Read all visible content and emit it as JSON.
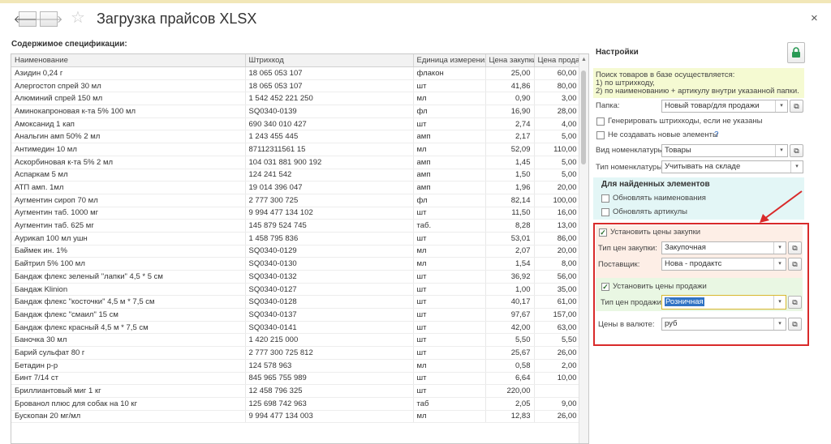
{
  "window": {
    "title": "Загрузка прайсов XLSX",
    "back_icon": "arrow-left-icon",
    "forward_icon": "arrow-right-icon",
    "favorite_icon": "star-icon",
    "close_glyph": "×"
  },
  "spec": {
    "section_label": "Содержимое спецификации:",
    "columns": [
      "Наименование",
      "Штрихкод",
      "Единица измерения",
      "Цена закупки",
      "Цена продажи"
    ],
    "rows": [
      [
        "Азидин 0,24 г",
        "18 065 053 107",
        "флакон",
        "25,00",
        "60,00"
      ],
      [
        "Алергостоп спрей 30 мл",
        "18 065 053 107",
        "шт",
        "41,86",
        "80,00"
      ],
      [
        "Алюминий спрей 150 мл",
        "1 542 452 221 250",
        "мл",
        "0,90",
        "3,00"
      ],
      [
        "Аминокапроновая к-та 5% 100 мл",
        "SQ0340-0139",
        "фл",
        "16,90",
        "28,00"
      ],
      [
        "Амоксанид 1 кап",
        "690 340 010 427",
        "шт",
        "2,74",
        "4,00"
      ],
      [
        "Анальгин амп 50% 2 мл",
        "1 243 455 445",
        "амп",
        "2,17",
        "5,00"
      ],
      [
        "Антимедин 10 мл",
        "87112311561 15",
        "мл",
        "52,09",
        "110,00"
      ],
      [
        "Аскорбиновая к-та 5% 2 мл",
        "104 031 881 900 192",
        "амп",
        "1,45",
        "5,00"
      ],
      [
        "Аспаркам 5 мл",
        "124 241 542",
        "амп",
        "1,50",
        "5,00"
      ],
      [
        "АТП амп. 1мл",
        "19 014 396 047",
        "амп",
        "1,96",
        "20,00"
      ],
      [
        "Аугментин сироп 70 мл",
        "2 777 300 725",
        "фл",
        "82,14",
        "100,00"
      ],
      [
        "Аугментин таб. 1000 мг",
        "9 994 477 134 102",
        "шт",
        "11,50",
        "16,00"
      ],
      [
        "Аугментин таб. 625 мг",
        "145 879 524 745",
        "таб.",
        "8,28",
        "13,00"
      ],
      [
        "Аурикап 100 мл ушн",
        "1 458 795 836",
        "шт",
        "53,01",
        "86,00"
      ],
      [
        "Баймек ин. 1%",
        "SQ0340-0129",
        "мл",
        "2,07",
        "20,00"
      ],
      [
        "Байтрил 5% 100 мл",
        "SQ0340-0130",
        "мл",
        "1,54",
        "8,00"
      ],
      [
        "Бандаж флекс зеленый \"лапки\" 4,5 * 5 см",
        "SQ0340-0132",
        "шт",
        "36,92",
        "56,00"
      ],
      [
        "Бандаж Klinion",
        "SQ0340-0127",
        "шт",
        "1,00",
        "35,00"
      ],
      [
        "Бандаж флекс \"косточки\" 4,5 м * 7,5 см",
        "SQ0340-0128",
        "шт",
        "40,17",
        "61,00"
      ],
      [
        "Бандаж флекс \"смаил\" 15 см",
        "SQ0340-0137",
        "шт",
        "97,67",
        "157,00"
      ],
      [
        "Бандаж флекс красный 4,5 м * 7,5 см",
        "SQ0340-0141",
        "шт",
        "42,00",
        "63,00"
      ],
      [
        "Баночка 30 мл",
        "1 420 215 000",
        "шт",
        "5,50",
        "5,50"
      ],
      [
        "Барий сульфат 80 г",
        "2 777 300 725 812",
        "шт",
        "25,67",
        "26,00"
      ],
      [
        "Бетадин р-р",
        "124 578 963",
        "мл",
        "0,58",
        "2,00"
      ],
      [
        "Бинт 7/14 ст",
        "845 965 755 989",
        "шт",
        "6,64",
        "10,00"
      ],
      [
        "Бриллиантовый миг 1 кг",
        "12 458 796 325",
        "шт",
        "220,00",
        ""
      ],
      [
        "Брованол плюс для собак на 10 кг",
        "125 698 742 963",
        "таб",
        "2,05",
        "9,00"
      ],
      [
        "Бускопан 20 мг/мл",
        "9 994 477 134 003",
        "мл",
        "12,83",
        "26,00"
      ]
    ]
  },
  "settings": {
    "title": "Настройки",
    "lock_icon": "lock-icon",
    "info_lines": [
      "Поиск товаров в базе осуществляется:",
      "1) по штрихкоду,",
      "2) по наименованию + артикулу внутри указанной папки."
    ],
    "folder": {
      "label": "Папка:",
      "value": "Новый товар/для продажи"
    },
    "generate_barcodes": {
      "label": "Генерировать штрихкоды, если не указаны",
      "checked": false
    },
    "no_new_items": {
      "label": "Не создавать новые элементы",
      "checked": false,
      "help": "?"
    },
    "item_kind": {
      "label": "Вид номенклатуры:",
      "value": "Товары"
    },
    "item_type": {
      "label": "Тип номенклатуры:",
      "value": "Учитывать на складе"
    },
    "found": {
      "title": "Для найденных элементов",
      "update_names": {
        "label": "Обновлять наименования",
        "checked": false
      },
      "update_articles": {
        "label": "Обновлять артикулы",
        "checked": false
      }
    },
    "purchase": {
      "set_prices": {
        "label": "Установить цены закупки",
        "checked": true
      },
      "price_type": {
        "label": "Тип цен закупки:",
        "value": "Закупочная"
      },
      "supplier": {
        "label": "Поставщик:",
        "value": "Нова - продактс"
      }
    },
    "sale": {
      "set_prices": {
        "label": "Установить цены продажи",
        "checked": true
      },
      "price_type": {
        "label": "Тип цен продажи:",
        "value": "Розничная"
      }
    },
    "currency": {
      "label": "Цены в валюте:",
      "value": "руб"
    },
    "colors": {
      "highlight_frame": "#d92a2a",
      "annotation_arrow": "#d92a2a",
      "selection": "#3173c4"
    }
  }
}
